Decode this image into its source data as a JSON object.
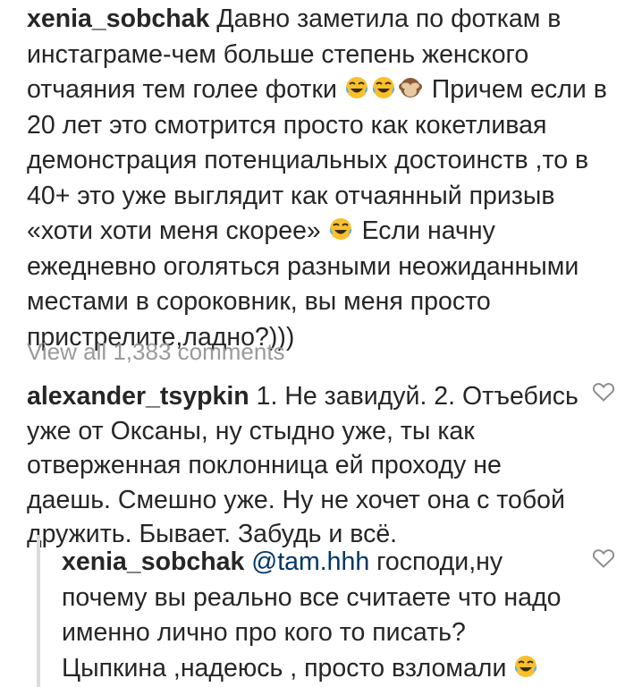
{
  "post": {
    "caption_user": "xenia_sobchak",
    "caption_part1": " Давно заметила по фоткам в инстаграме-чем больше степень женского отчаяния тем голее фотки ",
    "caption_part2": " Причем если в 20 лет это смотрится просто как кокетливая демонстрация потенциальных достоинств ,то в 40+ это уже выглядит как отчаянный призыв «хоти хоти меня скорее» ",
    "caption_part3": " Если начну ежедневно оголяться разными неожиданными местами в сороковник, вы меня просто пристрелите,ладно?)))",
    "view_all": "View all 1,383 comments"
  },
  "comments": [
    {
      "user": "alexander_tsypkin",
      "text": " 1. Не завидуй. 2. Отъебись уже от Оксаны, ну стыдно уже, ты как отверженная поклонница ей проходу не даешь. Смешно уже. Ну не хочет она с тобой дружить. Бывает. Забудь и всё.",
      "like_icon": "heart-outline-icon"
    }
  ],
  "replies": [
    {
      "user": "xenia_sobchak",
      "mention": "@tam.hhh",
      "text": " господи,ну почему вы реально все считаете что надо именно лично про кого то писать? Цыпкина ,надеюсь , просто взломали ",
      "like_icon": "heart-outline-icon"
    }
  ],
  "emoji": {
    "laughing": "face-with-tears-of-joy-icon",
    "monkey": "see-no-evil-monkey-icon"
  },
  "colors": {
    "text": "#262626",
    "muted": "#9a9a9a",
    "mention": "#003569",
    "reply_line": "#dbdbdb",
    "emoji_face": "#f9c02e"
  }
}
